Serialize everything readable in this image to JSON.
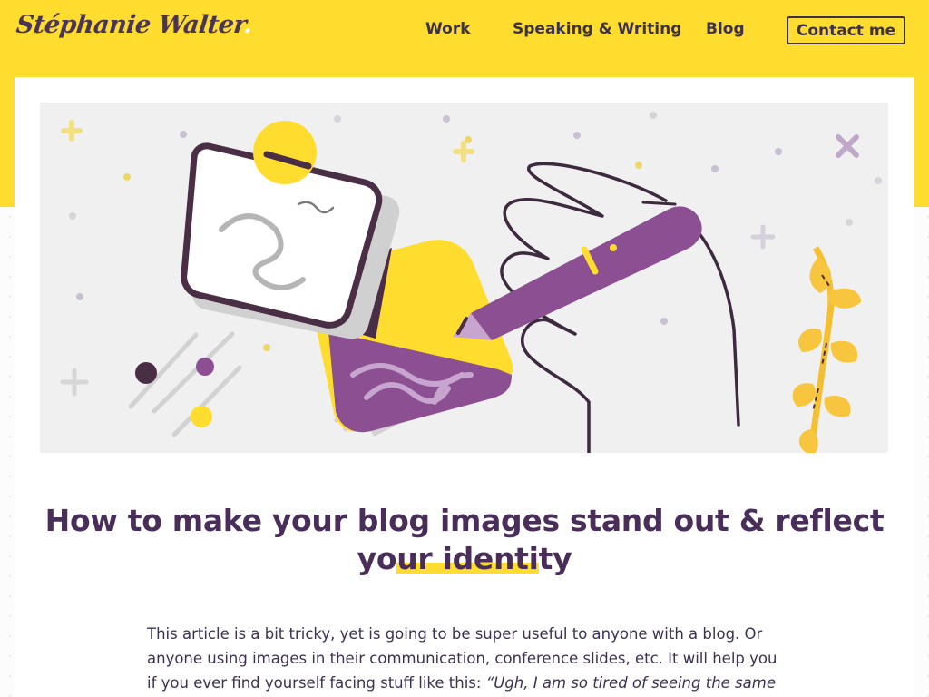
{
  "site": {
    "logo_text": "Stéphanie Walter",
    "logo_dot": "."
  },
  "nav": {
    "items": [
      {
        "label": "Work"
      },
      {
        "label": "Speaking & Writing"
      },
      {
        "label": "Blog",
        "current": true
      }
    ],
    "contact_label": "Contact me"
  },
  "hero": {
    "illustration": "stylus-drawing-illustration",
    "icons": [
      "hand-icon",
      "stylus-icon",
      "image-icon",
      "brush-icon",
      "slider-icon",
      "leaf-branch-icon",
      "sparkle-icon"
    ]
  },
  "article": {
    "title_before": "How to make your blog images stand out & reflect",
    "title_line2_start": "yo",
    "title_highlight": "ur identi",
    "title_line2_end": "ty",
    "intro_text": "This article is a bit tricky, yet is going to be super useful to anyone with a blog. Or anyone using images in their communication, conference slides, etc. It will help you if you ever find yourself facing stuff like this: ",
    "intro_quote": "“Ugh, I am so tired of seeing the same"
  },
  "colors": {
    "brand_yellow": "#ffdd2e",
    "brand_purple": "#4a2e5a",
    "accent_purple": "#8b4f92",
    "hero_background": "#f1f0f1"
  }
}
